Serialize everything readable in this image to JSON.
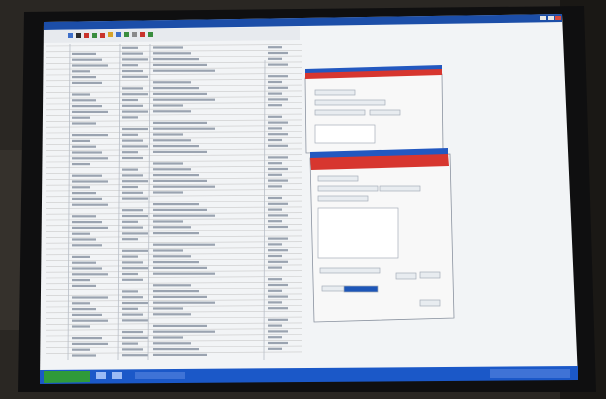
{
  "scene": {
    "description_colors": {
      "room": "#2a2723",
      "bezel": "#0f0f10",
      "screen_bg": "#f2f4f6",
      "titlebar": "#1c4ea8",
      "dialog_header": "#d7362f",
      "taskbar": "#1b58c8",
      "start_button": "#2f9a3a"
    },
    "icons": [
      "toolbar-icons",
      "window-controls-icon",
      "start-button-icon",
      "dialog-close-icon"
    ]
  }
}
